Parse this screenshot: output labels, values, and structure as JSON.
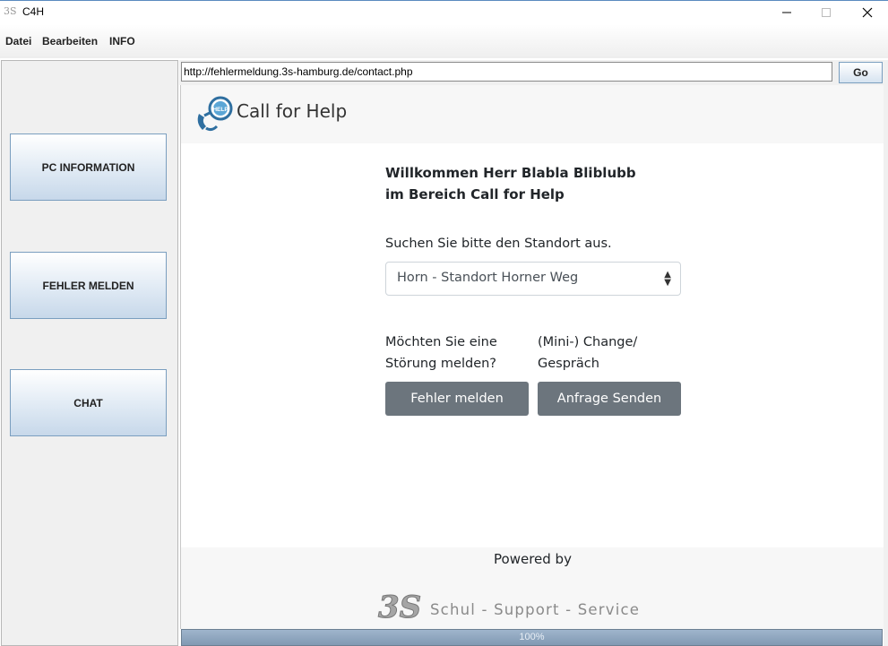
{
  "window": {
    "title": "C4H",
    "app_icon": "3S",
    "controls": [
      "minimize-icon",
      "maximize-icon",
      "close-icon"
    ]
  },
  "menu": {
    "items": [
      "Datei",
      "Bearbeiten",
      "INFO"
    ]
  },
  "sidebar": {
    "buttons": [
      "PC INFORMATION",
      "FEHLER MELDEN",
      "CHAT"
    ]
  },
  "browser": {
    "url": "http://fehlermeldung.3s-hamburg.de/contact.php",
    "go_label": "Go"
  },
  "page": {
    "brand": "Call for Help",
    "logo_badge": "HELP",
    "welcome": "Willkommen Herr Blabla Bliblubb im Bereich Call for Help",
    "location_prompt": "Suchen Sie bitte den Standort aus.",
    "location_selected": "Horn - Standort Horner Weg",
    "report_prompt_line1": "Möchten Sie eine",
    "report_prompt_line2": "Störung melden?",
    "change_prompt_line1": "(Mini-) Change/",
    "change_prompt_line2": "Gespräch",
    "report_button": "Fehler melden",
    "request_button": "Anfrage Senden",
    "powered_by": "Powered by",
    "company_logo": "3S",
    "company_name": "Schul - Support - Service"
  },
  "progress": {
    "value": 1.0,
    "label": "100%"
  },
  "colors": {
    "button_gray": "#6c757d",
    "nav_border": "#7a9ebf",
    "progress": "#8da4bd"
  }
}
